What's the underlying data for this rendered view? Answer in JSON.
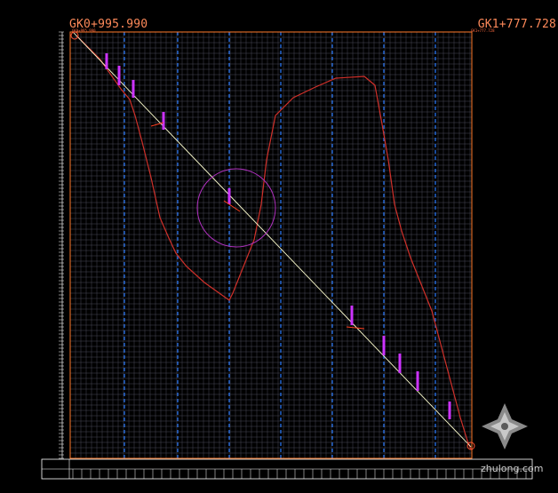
{
  "drawing": {
    "start_chainage": "GK0+995.990",
    "end_chainage": "GK1+777.728",
    "start_tag": "GK0+995.990",
    "end_tag": "GK1+777.728"
  },
  "watermark": "zhulong.com",
  "colors": {
    "background": "#000000",
    "grid_fine": "#5a5a66",
    "grid_major": "#2a7bff",
    "frame": "#ff7a2a",
    "profile_line": "#ffffd0",
    "boundary": "#d0302a",
    "marker": "#cc33ff",
    "circle": "#b030c0"
  }
}
